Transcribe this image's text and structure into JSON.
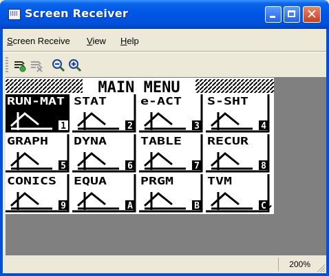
{
  "window": {
    "title": "Screen Receiver"
  },
  "menu": {
    "items": [
      {
        "label_first": "S",
        "label_rest": "creen Receive"
      },
      {
        "label_first": "V",
        "label_rest": "iew"
      },
      {
        "label_first": "H",
        "label_rest": "elp"
      }
    ]
  },
  "toolbar": {
    "icons": [
      "receive-icon",
      "stop-receive-icon",
      "zoom-out-icon",
      "zoom-in-icon"
    ]
  },
  "calc_screen": {
    "header": "MAIN MENU",
    "tiles": [
      {
        "label": "RUN-MAT",
        "number": "1"
      },
      {
        "label": "STAT",
        "number": "2"
      },
      {
        "label": "e-ACT",
        "number": "3"
      },
      {
        "label": "S-SHT",
        "number": "4"
      },
      {
        "label": "GRAPH",
        "number": "5"
      },
      {
        "label": "DYNA",
        "number": "6"
      },
      {
        "label": "TABLE",
        "number": "7"
      },
      {
        "label": "RECUR",
        "number": "8"
      },
      {
        "label": "CONICS",
        "number": "9"
      },
      {
        "label": "EQUA",
        "number": "A"
      },
      {
        "label": "PRGM",
        "number": "B"
      },
      {
        "label": "TVM",
        "number": "C"
      }
    ],
    "scroll_indicator": "↓"
  },
  "status": {
    "zoom": "200%"
  },
  "colors": {
    "titlebar": "#0055e5",
    "chrome": "#ece9d8",
    "client_bg": "#808080"
  }
}
